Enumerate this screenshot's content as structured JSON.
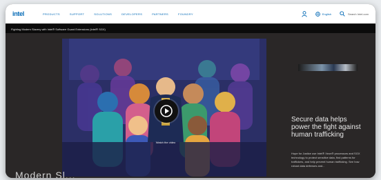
{
  "nav": {
    "logo": "intel",
    "links": [
      "PRODUCTS",
      "SUPPORT",
      "SOLUTIONS",
      "DEVELOPERS",
      "PARTNERS",
      "FOUNDRY"
    ],
    "language": "English",
    "search_placeholder": "Search Intel.com"
  },
  "breadcrumb": {
    "text": "Fighting Modern Slavery with Intel® Software Guard Extensions (Intel® SGX)"
  },
  "video": {
    "caption": "Watch the video",
    "headline": "Modern Sl..."
  },
  "promo": {
    "title": "Secure data helps power the fight against human trafficking",
    "body": "Hope for Justice use Intel® Xeon® processors and SGX technology to protect sensitive data, find patterns for traffickers, and help prevent human trafficking. See how robust data defenses and..."
  },
  "colors": {
    "accent": "#0068b5",
    "nav_bg": "#ffffff",
    "page_bg": "#2a2727",
    "video_bg": "#262a5e"
  }
}
